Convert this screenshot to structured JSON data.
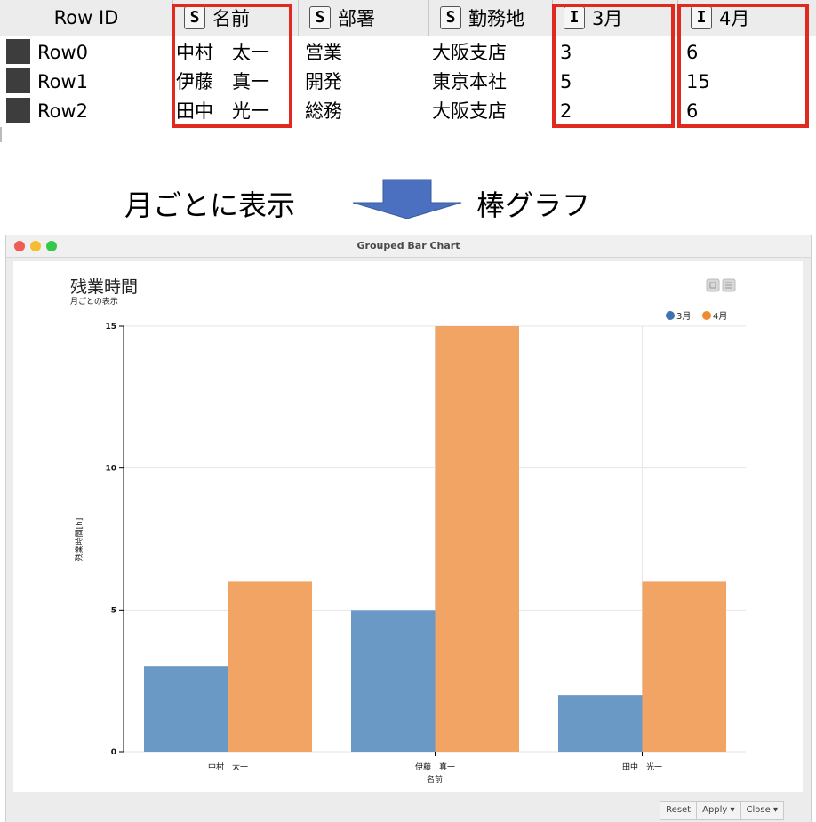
{
  "table": {
    "headers": [
      {
        "badge": "",
        "label": "Row ID"
      },
      {
        "badge": "S",
        "label": "名前"
      },
      {
        "badge": "S",
        "label": "部署"
      },
      {
        "badge": "S",
        "label": "勤務地"
      },
      {
        "badge": "I",
        "label": "3月"
      },
      {
        "badge": "I",
        "label": "4月"
      }
    ],
    "rows": [
      [
        "Row0",
        "中村　太一",
        "営業",
        "大阪支店",
        "3",
        "6"
      ],
      [
        "Row1",
        "伊藤　真一",
        "開発",
        "東京本社",
        "5",
        "15"
      ],
      [
        "Row2",
        "田中　光一",
        "総務",
        "大阪支店",
        "2",
        "6"
      ]
    ]
  },
  "caption": {
    "left": "月ごとに表示",
    "right": "棒グラフ"
  },
  "window": {
    "title": "Grouped Bar Chart",
    "footer_buttons": [
      "Reset",
      "Apply ▾",
      "Close ▾"
    ]
  },
  "colors": {
    "series_1": "#6b99c6",
    "series_2": "#f2a464",
    "legend_1": "#3f73b0",
    "legend_2": "#f08a30",
    "highlight": "#e0291f",
    "arrow": "#4a70bf"
  },
  "chart_data": {
    "type": "bar",
    "title": "残業時間",
    "subtitle": "月ごとの表示",
    "xlabel": "名前",
    "ylabel": "残業時間[h]",
    "categories": [
      "中村　太一",
      "伊藤　真一",
      "田中　光一"
    ],
    "series": [
      {
        "name": "3月",
        "values": [
          3,
          5,
          2
        ]
      },
      {
        "name": "4月",
        "values": [
          6,
          15,
          6
        ]
      }
    ],
    "ylim": [
      0,
      15
    ],
    "yticks": [
      "0",
      "5",
      "10",
      "15"
    ],
    "grid": true,
    "legend": "top-right"
  }
}
